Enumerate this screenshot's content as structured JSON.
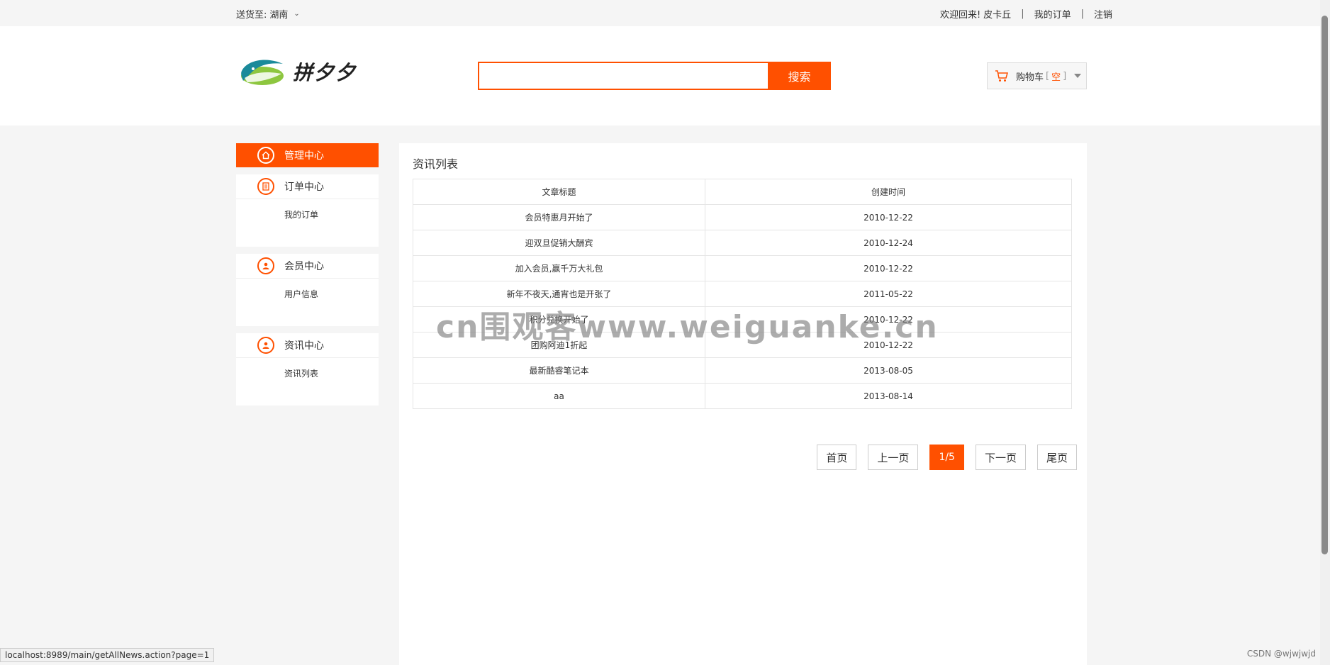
{
  "topbar": {
    "ship_to_label": "送货至:",
    "ship_to_value": "湖南",
    "welcome": "欢迎回来!",
    "username": "皮卡丘",
    "separator": "|",
    "my_orders": "我的订单",
    "logout": "注销"
  },
  "header": {
    "logo_text": "拼夕夕",
    "search": {
      "placeholder": "",
      "value": "",
      "button_label": "搜索"
    },
    "cart": {
      "label": "购物车",
      "open_bracket": "[",
      "status": "空",
      "close_bracket": "]"
    }
  },
  "sidebar": {
    "active": {
      "label": "管理中心",
      "icon": "home-icon"
    },
    "groups": [
      {
        "title": "订单中心",
        "icon": "document-icon",
        "items": [
          "我的订单"
        ]
      },
      {
        "title": "会员中心",
        "icon": "user-icon",
        "items": [
          "用户信息"
        ]
      },
      {
        "title": "资讯中心",
        "icon": "user-icon",
        "items": [
          "资讯列表"
        ]
      }
    ]
  },
  "main": {
    "title": "资讯列表",
    "table": {
      "headers": [
        "文章标题",
        "创建时间"
      ],
      "rows": [
        [
          "会员特惠月开始了",
          "2010-12-22"
        ],
        [
          "迎双旦促销大酬宾",
          "2010-12-24"
        ],
        [
          "加入会员,赢千万大礼包",
          "2010-12-22"
        ],
        [
          "新年不夜天,通宵也是开张了",
          "2011-05-22"
        ],
        [
          "积分兑换开始了",
          "2010-12-22"
        ],
        [
          "团购阿迪1折起",
          "2010-12-22"
        ],
        [
          "最新酷睿笔记本",
          "2013-08-05"
        ],
        [
          "aa",
          "2013-08-14"
        ]
      ]
    },
    "pager": {
      "first": "首页",
      "prev": "上一页",
      "current": "1/5",
      "next": "下一页",
      "last": "尾页"
    }
  },
  "watermark": "cn围观客www.weiguanke.cn",
  "statusbar": "localhost:8989/main/getAllNews.action?page=1",
  "credit": "CSDN @wjwjwjd",
  "colors": {
    "accent": "#ff5000",
    "background": "#f5f5f5"
  }
}
